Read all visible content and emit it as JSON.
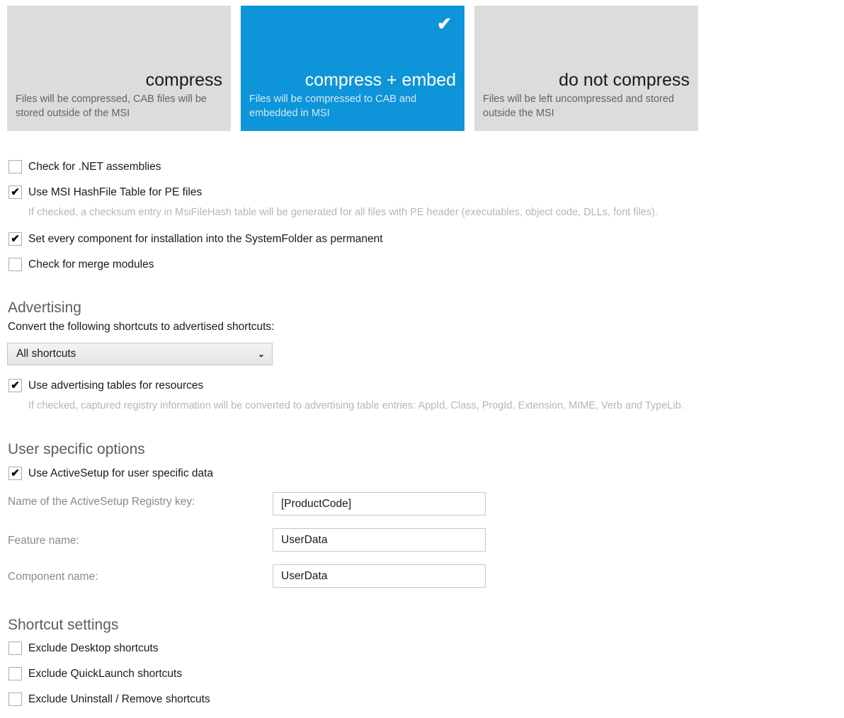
{
  "compression_tiles": [
    {
      "title": "compress",
      "description": "Files will be compressed, CAB files will be stored outside of the MSI",
      "selected": false
    },
    {
      "title": "compress + embed",
      "description": "Files will be compressed to CAB and embedded in MSI",
      "selected": true
    },
    {
      "title": "do not compress",
      "description": "Files will be left uncompressed and stored outside the MSI",
      "selected": false
    }
  ],
  "selected_tile_check_glyph": "✔",
  "general_options": [
    {
      "label": "Check for .NET assemblies",
      "checked": false
    },
    {
      "label": "Use MSI HashFile Table for PE files",
      "checked": true
    },
    {
      "label": "Set every component for installation into the SystemFolder as permanent",
      "checked": true
    },
    {
      "label": "Check for merge modules",
      "checked": false
    }
  ],
  "hashfile_hint": "If checked, a checksum entry in MsiFileHash table will be generated for all files with PE header (executables, object code, DLLs, font files).",
  "advertising": {
    "heading": "Advertising",
    "description": "Convert the following shortcuts to advertised shortcuts:",
    "dropdown_value": "All shortcuts",
    "dropdown_arrow_glyph": "⌄",
    "checkbox": {
      "label": "Use advertising tables for resources",
      "checked": true
    },
    "hint": "If checked, captured registry information will be converted to advertising table entries: AppId, Class, ProgId, Extension, MIME, Verb and TypeLib."
  },
  "user_specific": {
    "heading": "User specific options",
    "checkbox": {
      "label": "Use ActiveSetup for user specific data",
      "checked": true
    },
    "fields": [
      {
        "label": "Name of the ActiveSetup Registry key:",
        "value": "[ProductCode]"
      },
      {
        "label": "Feature name:",
        "value": "UserData"
      },
      {
        "label": "Component name:",
        "value": "UserData"
      }
    ]
  },
  "shortcut_settings": {
    "heading": "Shortcut settings",
    "options": [
      {
        "label": "Exclude Desktop shortcuts",
        "checked": false
      },
      {
        "label": "Exclude QuickLaunch shortcuts",
        "checked": false
      },
      {
        "label": "Exclude Uninstall / Remove shortcuts",
        "checked": false
      }
    ]
  },
  "colors": {
    "accent": "#0e94d8",
    "tile_idle": "#dcdcdc",
    "hint_text": "#b6b6b6",
    "heading_text": "#5d5d5d"
  }
}
